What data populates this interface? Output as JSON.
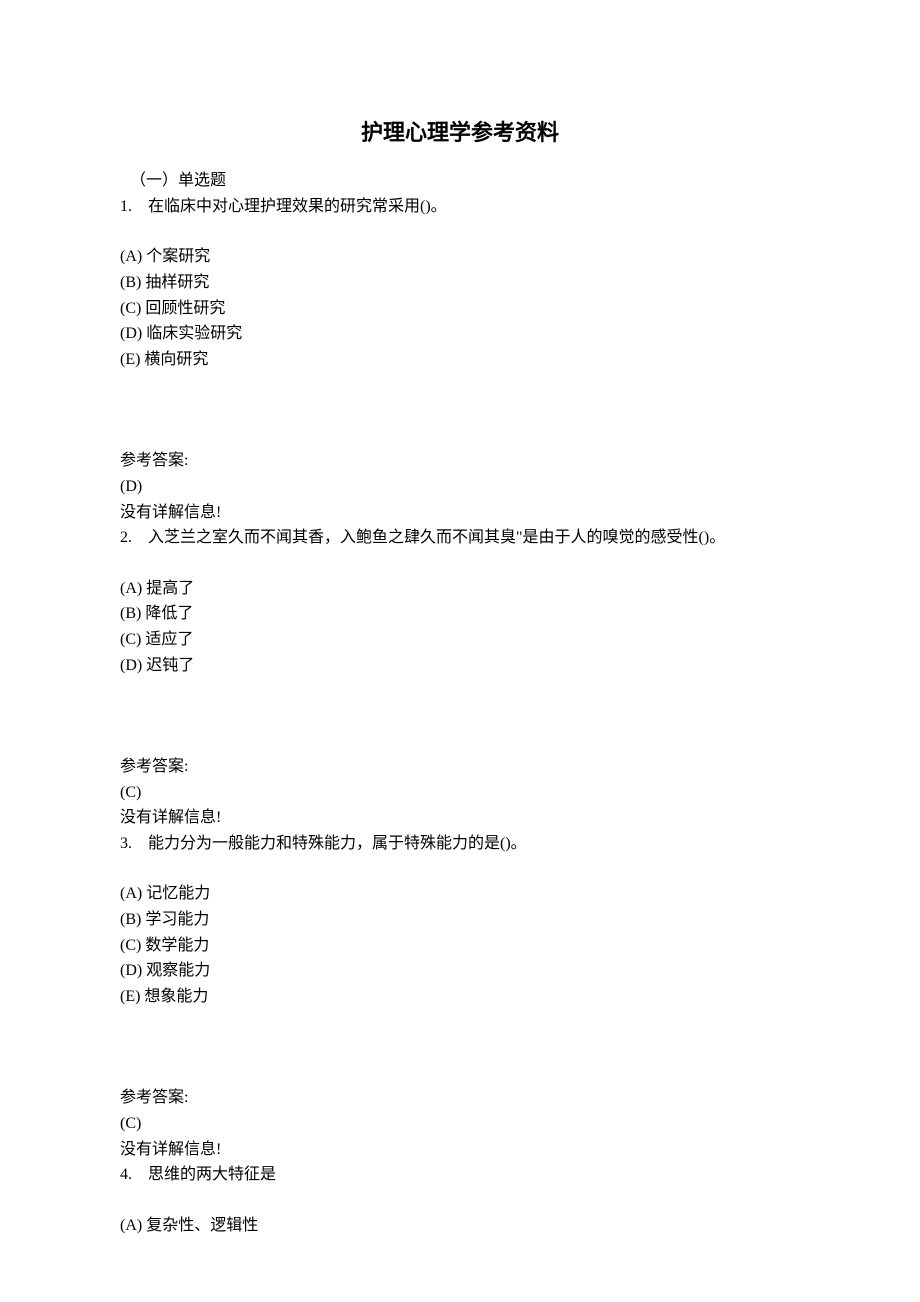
{
  "title": "护理心理学参考资料",
  "section_header": "（一）单选题",
  "questions": [
    {
      "num": "1.",
      "stem": "在临床中对心理护理效果的研究常采用()。",
      "options": [
        "(A) 个案研究",
        "(B) 抽样研究",
        "(C) 回顾性研究",
        "(D) 临床实验研究",
        "(E) 横向研究"
      ],
      "answer_label": "参考答案:",
      "answer": "(D)",
      "no_detail": "没有详解信息!"
    },
    {
      "num": "2.",
      "stem": "入芝兰之室久而不闻其香，入鲍鱼之肆久而不闻其臭\"是由于人的嗅觉的感受性()。",
      "options": [
        "(A) 提高了",
        "(B) 降低了",
        "(C) 适应了",
        "(D) 迟钝了"
      ],
      "answer_label": "参考答案:",
      "answer": "(C)",
      "no_detail": "没有详解信息!"
    },
    {
      "num": "3.",
      "stem": "能力分为一般能力和特殊能力，属于特殊能力的是()。",
      "options": [
        "(A) 记忆能力",
        "(B) 学习能力",
        "(C) 数学能力",
        "(D) 观察能力",
        "(E) 想象能力"
      ],
      "answer_label": "参考答案:",
      "answer": "(C)",
      "no_detail": "没有详解信息!"
    },
    {
      "num": "4.",
      "stem": "思维的两大特征是",
      "options": [
        "(A) 复杂性、逻辑性"
      ],
      "answer_label": "",
      "answer": "",
      "no_detail": ""
    }
  ]
}
